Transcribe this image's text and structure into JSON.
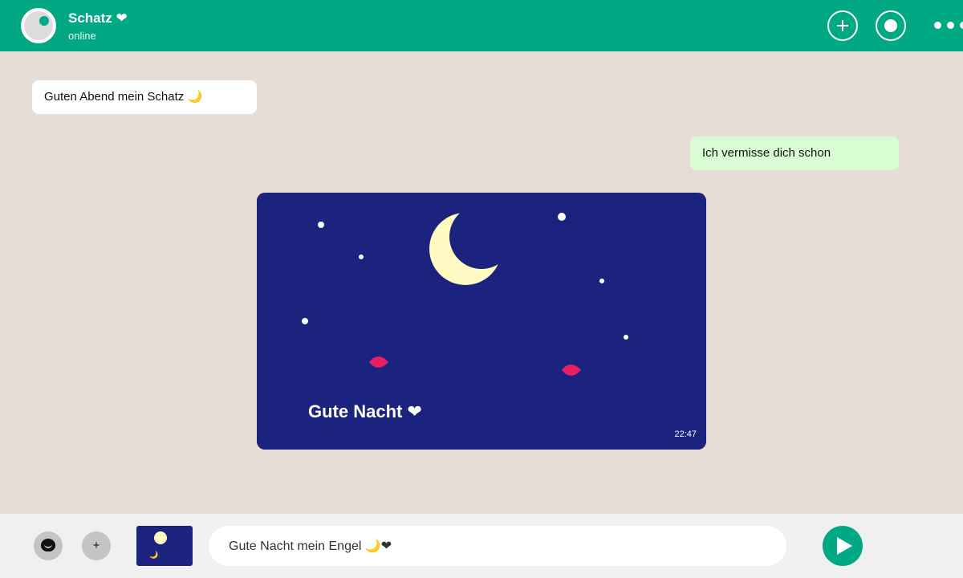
{
  "header": {
    "contact_name": "Schatz ❤",
    "contact_status": "online",
    "new_chat_icon": "plus-icon",
    "status_icon": "status-icon",
    "more_icon": "more-icon"
  },
  "messages": [
    {
      "direction": "incoming",
      "text": "Guten Abend mein Schatz 🌙"
    },
    {
      "direction": "outgoing",
      "text": "Ich vermisse dich schon"
    }
  ],
  "image_card": {
    "caption": "Gute Nacht ❤",
    "time": "22:47"
  },
  "composer": {
    "emoji_icon": "emoji-icon",
    "attach_label": "+",
    "thumbnail_label": "🌙",
    "input_value": "Gute Nacht mein Engel 🌙❤",
    "send_icon": "send-icon"
  },
  "colors": {
    "brand": "#00a884",
    "chat_background": "#e6ddd6",
    "outgoing_bubble": "#d9fdd3",
    "incoming_bubble": "#ffffff",
    "card_background": "#1b237e",
    "moon": "#fffbc1",
    "accent_pink": "#e91e63"
  }
}
